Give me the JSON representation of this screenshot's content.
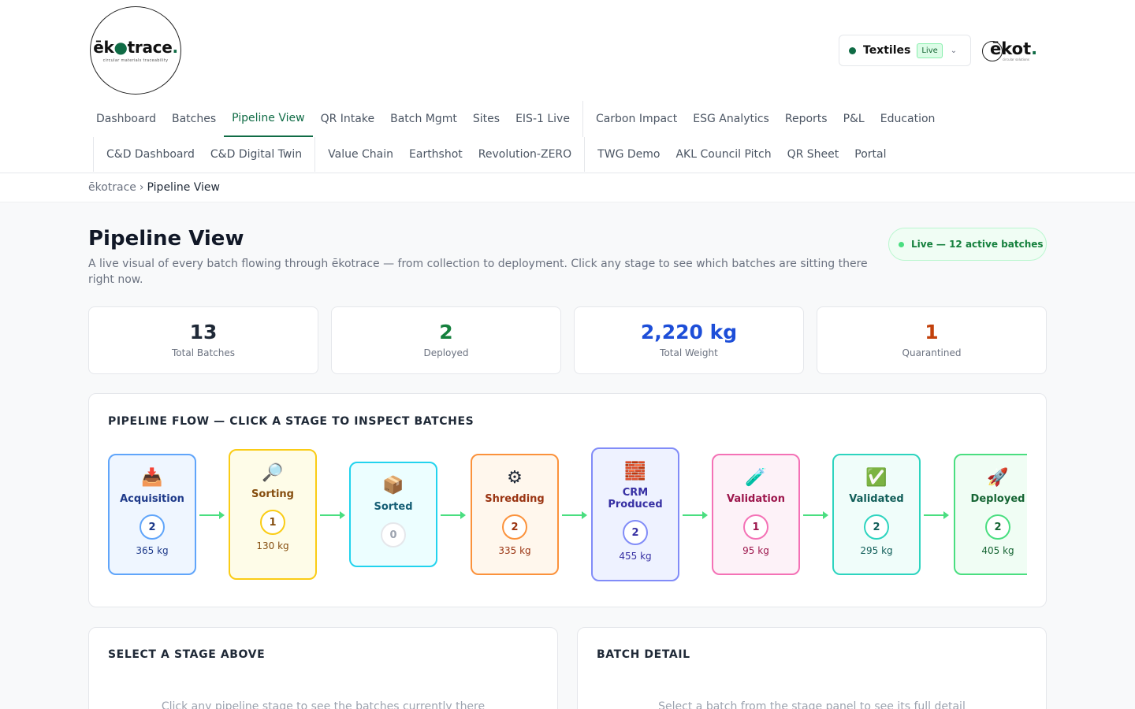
{
  "brand": {
    "logo_word_pre": "ēk",
    "logo_word_post": "trace",
    "logo_dot": ".",
    "logo_tagline": "circular materials traceability",
    "right_logo_word": "ēkot",
    "right_logo_dot": ".",
    "right_logo_tagline": "circular solutions"
  },
  "sector": {
    "name": "Textiles",
    "badge": "Live",
    "chevron": "⌄"
  },
  "nav": {
    "row1a": [
      "Dashboard",
      "Batches",
      "Pipeline View",
      "QR Intake",
      "Batch Mgmt",
      "Sites",
      "EIS-1 Live"
    ],
    "row1b": [
      "Carbon Impact",
      "ESG Analytics",
      "Reports",
      "P&L",
      "Education"
    ],
    "row2a": [
      "C&D Dashboard",
      "C&D Digital Twin"
    ],
    "row2b": [
      "Value Chain",
      "Earthshot",
      "Revolution-ZERO"
    ],
    "row2c": [
      "TWG Demo",
      "AKL Council Pitch",
      "QR Sheet",
      "Portal"
    ],
    "active": "Pipeline View"
  },
  "breadcrumb": {
    "root": "ēkotrace",
    "sep": "›",
    "current": "Pipeline View"
  },
  "page": {
    "title": "Pipeline View",
    "description": "A live visual of every batch flowing through ēkotrace — from collection to deployment. Click any stage to see which batches are sitting there right now.",
    "live_pill": "Live — 12 active batches"
  },
  "stats": [
    {
      "value": "13",
      "label": "Total Batches",
      "color": "#1f2937"
    },
    {
      "value": "2",
      "label": "Deployed",
      "color": "#15803d"
    },
    {
      "value": "2,220 kg",
      "label": "Total Weight",
      "color": "#1d4ed8"
    },
    {
      "value": "1",
      "label": "Quarantined",
      "color": "#c2410c"
    }
  ],
  "pipeline": {
    "title": "PIPELINE FLOW — CLICK A STAGE TO INSPECT BATCHES",
    "stages": [
      {
        "name": "Acquisition",
        "icon": "📥",
        "count": "2",
        "weight": "365 kg",
        "border": "#60a5fa",
        "bg": "#eff6ff",
        "text": "#1e3a8a"
      },
      {
        "name": "Sorting",
        "icon": "🔎",
        "count": "1",
        "weight": "130 kg",
        "border": "#facc15",
        "bg": "#fefce8",
        "text": "#854d0e"
      },
      {
        "name": "Sorted",
        "icon": "📦",
        "count": "0",
        "weight": "",
        "border": "#22d3ee",
        "bg": "#ecfeff",
        "text": "#155e75"
      },
      {
        "name": "Shredding",
        "icon": "⚙",
        "count": "2",
        "weight": "335 kg",
        "border": "#fb923c",
        "bg": "#fff7ed",
        "text": "#9a3412"
      },
      {
        "name": "CRM Produced",
        "icon": "🧱",
        "count": "2",
        "weight": "455 kg",
        "border": "#818cf8",
        "bg": "#eef2ff",
        "text": "#3730a3"
      },
      {
        "name": "Validation",
        "icon": "🧪",
        "count": "1",
        "weight": "95 kg",
        "border": "#f472b6",
        "bg": "#fdf2f8",
        "text": "#9d174d"
      },
      {
        "name": "Validated",
        "icon": "✅",
        "count": "2",
        "weight": "295 kg",
        "border": "#2dd4bf",
        "bg": "#f0fdfa",
        "text": "#115e59"
      },
      {
        "name": "Deployed",
        "icon": "🚀",
        "count": "2",
        "weight": "405 kg",
        "border": "#4ade80",
        "bg": "#f0fdf4",
        "text": "#166534"
      }
    ]
  },
  "stage_panel": {
    "title": "SELECT A STAGE ABOVE",
    "empty": "Click any pipeline stage to see the batches currently there"
  },
  "detail_panel": {
    "title": "BATCH DETAIL",
    "empty": "Select a batch from the stage panel to see its full detail"
  }
}
